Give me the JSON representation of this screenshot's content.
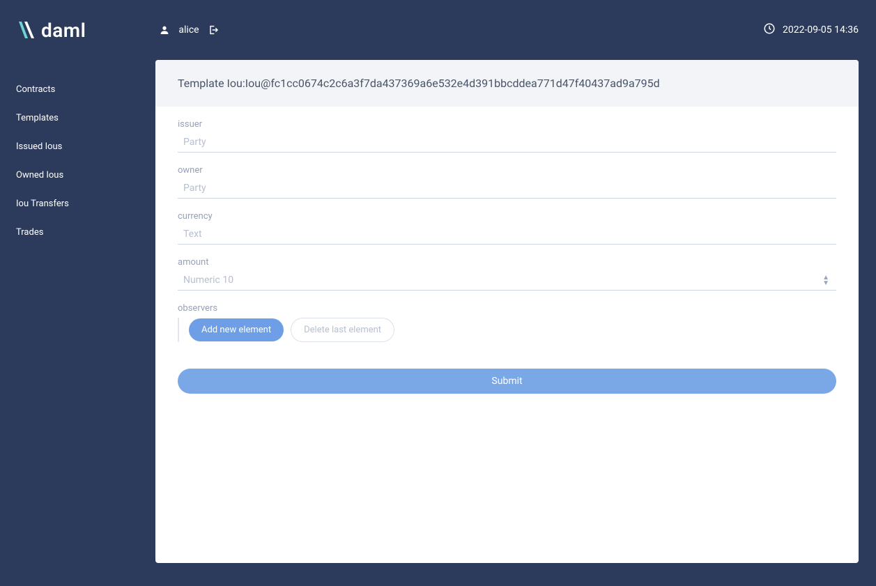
{
  "header": {
    "logo_text": "daml",
    "username": "alice",
    "timestamp": "2022-09-05 14:36"
  },
  "sidebar": {
    "items": [
      {
        "label": "Contracts"
      },
      {
        "label": "Templates"
      },
      {
        "label": "Issued Ious"
      },
      {
        "label": "Owned Ious"
      },
      {
        "label": "Iou Transfers"
      },
      {
        "label": "Trades"
      }
    ]
  },
  "panel": {
    "title": "Template Iou:Iou@fc1cc0674c2c6a3f7da437369a6e532e4d391bbcddea771d47f40437ad9a795d"
  },
  "form": {
    "fields": {
      "issuer": {
        "label": "issuer",
        "placeholder": "Party"
      },
      "owner": {
        "label": "owner",
        "placeholder": "Party"
      },
      "currency": {
        "label": "currency",
        "placeholder": "Text"
      },
      "amount": {
        "label": "amount",
        "placeholder": "Numeric 10"
      },
      "observers": {
        "label": "observers"
      }
    },
    "buttons": {
      "add_element": "Add new element",
      "delete_element": "Delete last element",
      "submit": "Submit"
    }
  }
}
